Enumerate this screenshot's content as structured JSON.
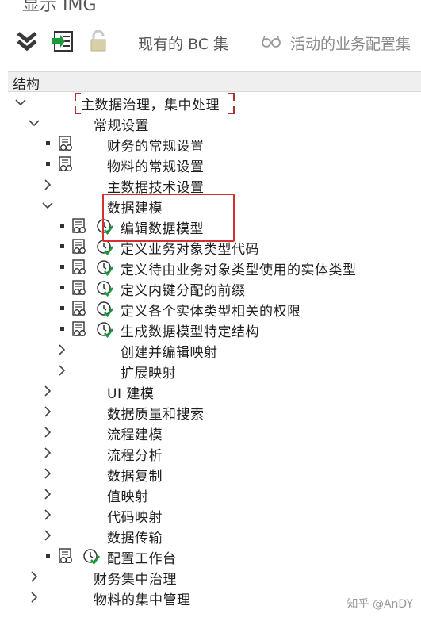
{
  "window": {
    "title": "显示 IMG"
  },
  "toolbar": {
    "existing_bc_label": "现有的 BC 集",
    "active_config_label": "活动的业务配置集"
  },
  "column_header": "结构",
  "tree": {
    "root": "主数据治理，集中处理",
    "general_settings": "常规设置",
    "finance_general": "财务的常规设置",
    "material_general": "物料的常规设置",
    "md_tech_settings": "主数据技术设置",
    "data_modeling": "数据建模",
    "edit_data_model": "编辑数据模型",
    "define_bo_type_code": "定义业务对象类型代码",
    "define_entity_types": "定义待由业务对象类型使用的实体类型",
    "define_prefix": "定义内键分配的前缀",
    "define_auth": "定义各个实体类型相关的权限",
    "gen_structures": "生成数据模型特定结构",
    "create_edit_mapping": "创建并编辑映射",
    "extend_mapping": "扩展映射",
    "ui_modeling": "UI 建模",
    "data_quality": "数据质量和搜索",
    "process_modeling": "流程建模",
    "process_analysis": "流程分析",
    "data_replication": "数据复制",
    "value_mapping": "值映射",
    "code_mapping": "代码映射",
    "data_transfer": "数据传输",
    "config_workbench": "配置工作台",
    "finance_central": "财务集中治理",
    "material_central": "物料的集中管理"
  },
  "watermark": "知乎 @AnDY",
  "colors": {
    "highlight_box": "#d43030",
    "check_green": "#1c9a3c"
  }
}
